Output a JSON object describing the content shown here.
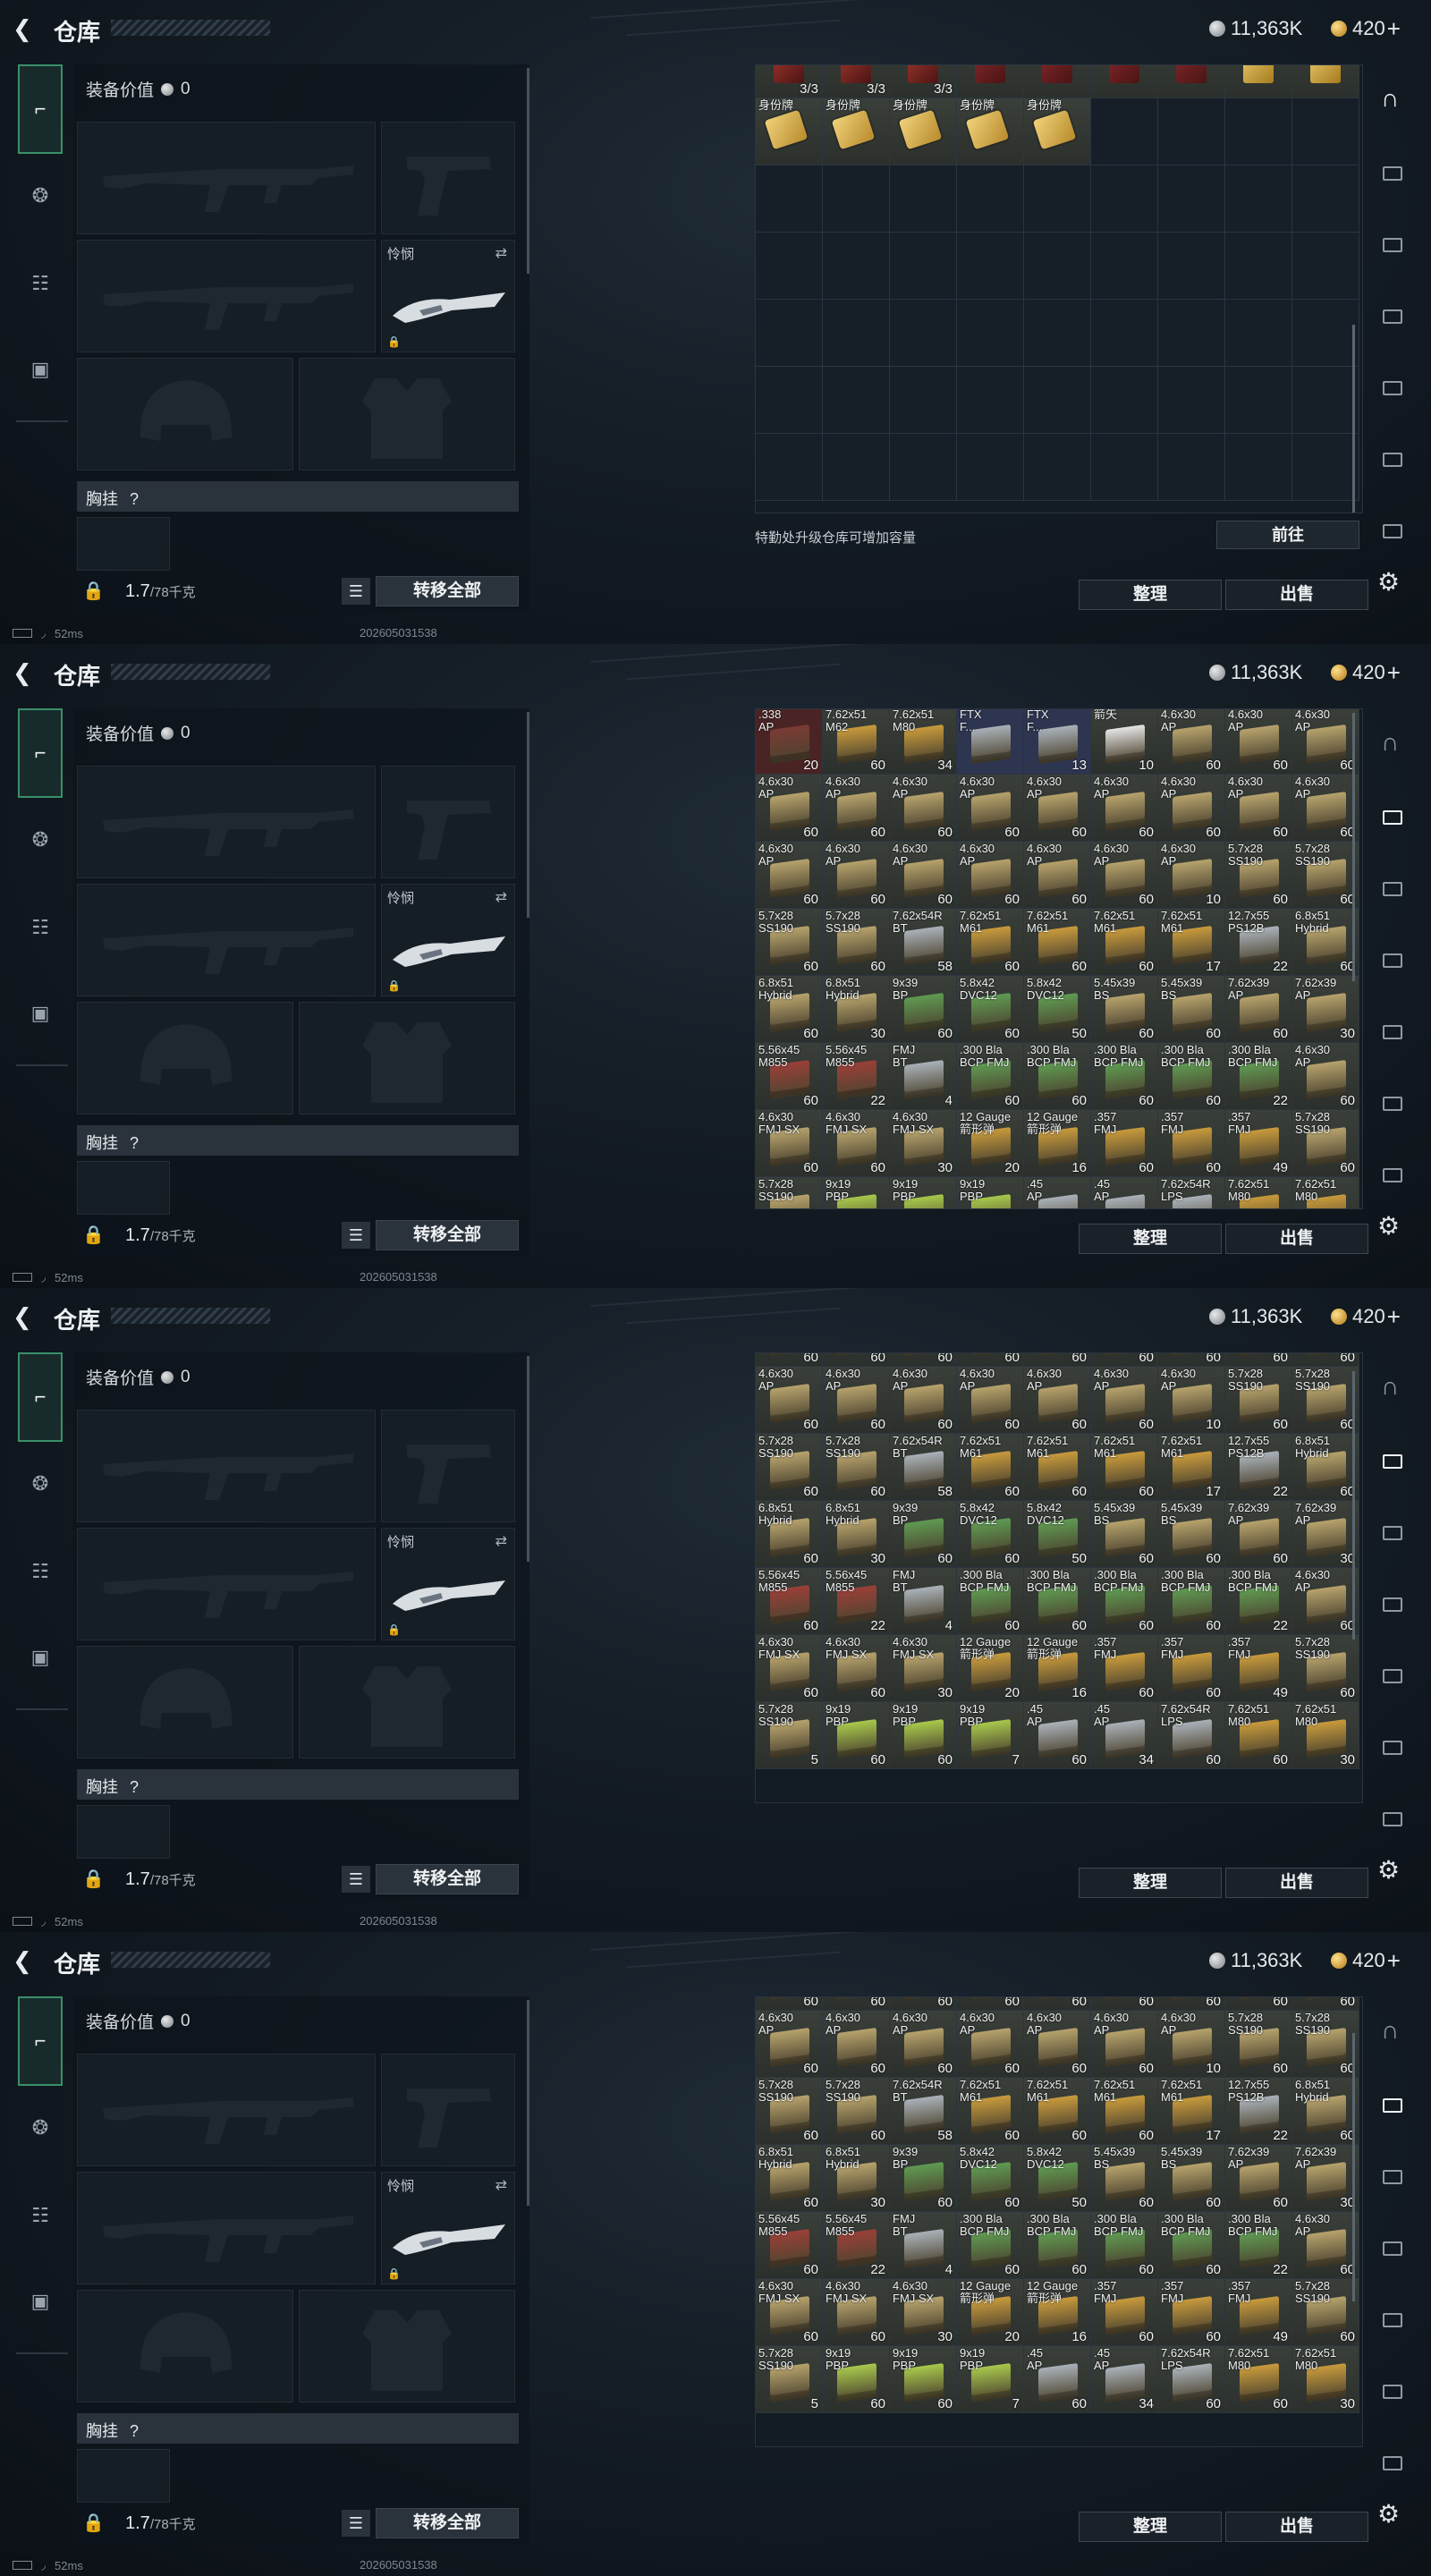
{
  "header": {
    "title": "仓库",
    "silver": "11,363K",
    "gold": "420",
    "gold_plus": "+"
  },
  "equipment": {
    "value_label": "装备价值",
    "value": "0",
    "melee_label": "怜悯",
    "chest_label": "胸挂",
    "chest_help": "?",
    "weight": "1.7",
    "weight_max": "/78千克",
    "transfer_all": "转移全部"
  },
  "status": {
    "ping": "52ms",
    "build": "202605031538"
  },
  "storage": {
    "upgrade_hint": "特勤处升级仓库可增加容量",
    "goto": "前往",
    "sort": "整理",
    "sell": "出售"
  },
  "colors": {
    "ammo_box": "#b6a26c",
    "ammo_gold": "#c89a3c",
    "ammo_green": "#5f9a52",
    "ammo_red": "#9a4038",
    "ammo_silver": "#a9b1b8",
    "accent_green": "#3a8f6a"
  },
  "icons": {
    "back": "back-arrow-icon",
    "rail": [
      "pistol-icon",
      "helmet-icon",
      "vest-icon",
      "briefcase-icon"
    ],
    "right_rail": [
      "storage-arch-icon",
      "storage-tab-icon",
      "settings-gear-icon"
    ]
  },
  "grid_top": [
    {
      "n": "",
      "c": "3/3",
      "t": "gem",
      "col": "#a83a2e"
    },
    {
      "n": "",
      "c": "3/3",
      "t": "gem",
      "col": "#a83a2e"
    },
    {
      "n": "",
      "c": "3/3",
      "t": "gem",
      "col": "#a83a2e"
    },
    {
      "n": "",
      "c": "",
      "t": "gem",
      "col": "#8a2a2e"
    },
    {
      "n": "",
      "c": "",
      "t": "gem",
      "col": "#8a2a2e"
    },
    {
      "n": "",
      "c": "",
      "t": "gem",
      "col": "#8a2a2e"
    },
    {
      "n": "",
      "c": "",
      "t": "gem",
      "col": "#8a2a2e"
    },
    {
      "n": "",
      "c": "",
      "t": "gold",
      "col": "#d8b450"
    },
    {
      "n": "",
      "c": "",
      "t": "gold",
      "col": "#d8b450"
    },
    {
      "n": "身份牌",
      "c": "",
      "t": "tag",
      "col": "#c9a845"
    },
    {
      "n": "身份牌",
      "c": "",
      "t": "tag",
      "col": "#c9a845"
    },
    {
      "n": "身份牌",
      "c": "",
      "t": "tag",
      "col": "#c9a845"
    },
    {
      "n": "身份牌",
      "c": "",
      "t": "tag",
      "col": "#c9a845"
    },
    {
      "n": "身份牌",
      "c": "",
      "t": "tag",
      "col": "#c9a845"
    }
  ],
  "ammo_rows": [
    [
      {
        "n": ".338\nAP",
        "c": "20",
        "col": "#7a3a34",
        "bg": "#4a2424"
      },
      {
        "n": "7.62x51\nM62",
        "c": "60",
        "col": "#c89a3c"
      },
      {
        "n": "7.62x51\nM80",
        "c": "34",
        "col": "#c89a3c"
      },
      {
        "n": "FTX\nF...",
        "c": "",
        "col": "#a9b1b8",
        "bg": "#2e3550"
      },
      {
        "n": "FTX\nF...",
        "c": "13",
        "col": "#a9b1b8",
        "bg": "#2e3550"
      },
      {
        "n": "箭矢",
        "c": "10",
        "col": "#e4e4e4"
      },
      {
        "n": "4.6x30\nAP",
        "c": "60",
        "col": "#b6a26c"
      },
      {
        "n": "4.6x30\nAP",
        "c": "60",
        "col": "#b6a26c"
      },
      {
        "n": "4.6x30\nAP",
        "c": "60",
        "col": "#b6a26c"
      }
    ],
    [
      {
        "n": "4.6x30\nAP",
        "c": "60",
        "col": "#b6a26c"
      },
      {
        "n": "4.6x30\nAP",
        "c": "60",
        "col": "#b6a26c"
      },
      {
        "n": "4.6x30\nAP",
        "c": "60",
        "col": "#b6a26c"
      },
      {
        "n": "4.6x30\nAP",
        "c": "60",
        "col": "#b6a26c"
      },
      {
        "n": "4.6x30\nAP",
        "c": "60",
        "col": "#b6a26c"
      },
      {
        "n": "4.6x30\nAP",
        "c": "60",
        "col": "#b6a26c"
      },
      {
        "n": "4.6x30\nAP",
        "c": "60",
        "col": "#b6a26c"
      },
      {
        "n": "4.6x30\nAP",
        "c": "60",
        "col": "#b6a26c"
      },
      {
        "n": "4.6x30\nAP",
        "c": "60",
        "col": "#b6a26c"
      }
    ],
    [
      {
        "n": "4.6x30\nAP",
        "c": "60",
        "col": "#b6a26c"
      },
      {
        "n": "4.6x30\nAP",
        "c": "60",
        "col": "#b6a26c"
      },
      {
        "n": "4.6x30\nAP",
        "c": "60",
        "col": "#b6a26c"
      },
      {
        "n": "4.6x30\nAP",
        "c": "60",
        "col": "#b6a26c"
      },
      {
        "n": "4.6x30\nAP",
        "c": "60",
        "col": "#b6a26c"
      },
      {
        "n": "4.6x30\nAP",
        "c": "60",
        "col": "#b6a26c"
      },
      {
        "n": "4.6x30\nAP",
        "c": "10",
        "col": "#b6a26c"
      },
      {
        "n": "5.7x28\nSS190",
        "c": "60",
        "col": "#b6a26c"
      },
      {
        "n": "5.7x28\nSS190",
        "c": "60",
        "col": "#b6a26c"
      }
    ],
    [
      {
        "n": "5.7x28\nSS190",
        "c": "60",
        "col": "#b6a26c"
      },
      {
        "n": "5.7x28\nSS190",
        "c": "60",
        "col": "#b6a26c"
      },
      {
        "n": "7.62x54R\nBT",
        "c": "58",
        "col": "#a9b1b8"
      },
      {
        "n": "7.62x51\nM61",
        "c": "60",
        "col": "#c89a3c"
      },
      {
        "n": "7.62x51\nM61",
        "c": "60",
        "col": "#c89a3c"
      },
      {
        "n": "7.62x51\nM61",
        "c": "60",
        "col": "#c89a3c"
      },
      {
        "n": "7.62x51\nM61",
        "c": "17",
        "col": "#c89a3c"
      },
      {
        "n": "12.7x55\nPS12B",
        "c": "22",
        "col": "#a9b1b8"
      },
      {
        "n": "6.8x51\nHybrid",
        "c": "60",
        "col": "#b6a26c"
      }
    ],
    [
      {
        "n": "6.8x51\nHybrid",
        "c": "60",
        "col": "#b6a26c"
      },
      {
        "n": "6.8x51\nHybrid",
        "c": "30",
        "col": "#b6a26c"
      },
      {
        "n": "9x39\nBP",
        "c": "60",
        "col": "#5f9a52"
      },
      {
        "n": "5.8x42\nDVC12",
        "c": "60",
        "col": "#5f9a52"
      },
      {
        "n": "5.8x42\nDVC12",
        "c": "50",
        "col": "#5f9a52"
      },
      {
        "n": "5.45x39\nBS",
        "c": "60",
        "col": "#b6a26c"
      },
      {
        "n": "5.45x39\nBS",
        "c": "60",
        "col": "#b6a26c"
      },
      {
        "n": "7.62x39\nAP",
        "c": "60",
        "col": "#b6a26c"
      },
      {
        "n": "7.62x39\nAP",
        "c": "30",
        "col": "#b6a26c"
      }
    ],
    [
      {
        "n": "5.56x45\nM855",
        "c": "60",
        "col": "#9a4038"
      },
      {
        "n": "5.56x45\nM855",
        "c": "22",
        "col": "#9a4038"
      },
      {
        "n": "FMJ\nBT",
        "c": "4",
        "col": "#a9b1b8"
      },
      {
        "n": ".300 Bla\nBCP FMJ",
        "c": "60",
        "col": "#5f9a52"
      },
      {
        "n": ".300 Bla\nBCP FMJ",
        "c": "60",
        "col": "#5f9a52"
      },
      {
        "n": ".300 Bla\nBCP FMJ",
        "c": "60",
        "col": "#5f9a52"
      },
      {
        "n": ".300 Bla\nBCP FMJ",
        "c": "60",
        "col": "#5f9a52"
      },
      {
        "n": ".300 Bla\nBCP FMJ",
        "c": "22",
        "col": "#5f9a52"
      },
      {
        "n": "4.6x30\nAP",
        "c": "60",
        "col": "#b6a26c"
      }
    ],
    [
      {
        "n": "4.6x30\nFMJ SX",
        "c": "60",
        "col": "#b6a26c"
      },
      {
        "n": "4.6x30\nFMJ SX",
        "c": "60",
        "col": "#b6a26c"
      },
      {
        "n": "4.6x30\nFMJ SX",
        "c": "30",
        "col": "#b6a26c"
      },
      {
        "n": "12 Gauge\n箭形弹",
        "c": "20",
        "col": "#c89a3c"
      },
      {
        "n": "12 Gauge\n箭形弹",
        "c": "16",
        "col": "#c89a3c"
      },
      {
        "n": ".357\nFMJ",
        "c": "60",
        "col": "#c89a3c"
      },
      {
        "n": ".357\nFMJ",
        "c": "60",
        "col": "#c89a3c"
      },
      {
        "n": ".357\nFMJ",
        "c": "49",
        "col": "#c89a3c"
      },
      {
        "n": "5.7x28\nSS190",
        "c": "60",
        "col": "#b6a26c"
      }
    ],
    [
      {
        "n": "5.7x28\nSS190",
        "c": "5",
        "col": "#b6a26c"
      },
      {
        "n": "9x19\nPBP",
        "c": "60",
        "col": "#a8c84c"
      },
      {
        "n": "9x19\nPBP",
        "c": "60",
        "col": "#a8c84c"
      },
      {
        "n": "9x19\nPBP",
        "c": "7",
        "col": "#a8c84c"
      },
      {
        "n": ".45\nAP",
        "c": "60",
        "col": "#a9b1b8"
      },
      {
        "n": ".45\nAP",
        "c": "34",
        "col": "#a9b1b8"
      },
      {
        "n": "7.62x54R\nLPS",
        "c": "60",
        "col": "#a9b1b8"
      },
      {
        "n": "7.62x51\nM80",
        "c": "60",
        "col": "#c89a3c"
      },
      {
        "n": "7.62x51\nM80",
        "c": "30",
        "col": "#c89a3c"
      }
    ]
  ]
}
